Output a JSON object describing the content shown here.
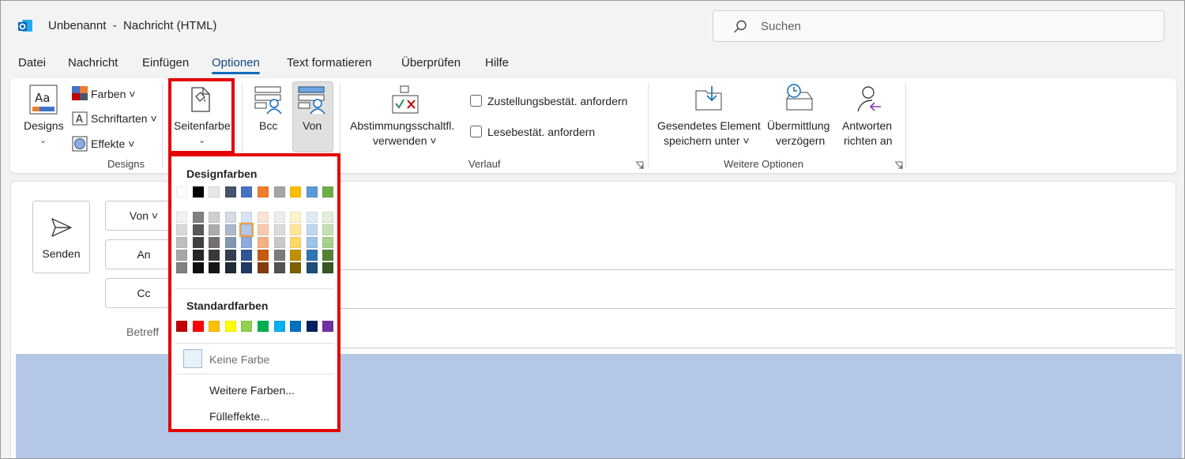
{
  "window": {
    "title": "Unbenannt  -  Nachricht (HTML)",
    "search_placeholder": "Suchen"
  },
  "menu": {
    "tabs": [
      "Datei",
      "Nachricht",
      "Einfügen",
      "Optionen",
      "Text formatieren",
      "Überprüfen",
      "Hilfe"
    ],
    "active_tab": "Optionen"
  },
  "ribbon": {
    "designs_group": {
      "designs_button": "Designs",
      "farben": "Farben",
      "schriftarten": "Schriftarten",
      "effekte": "Effekte",
      "label": "Designs"
    },
    "seitenfarbe": "Seitenfarbe",
    "bcc": "Bcc",
    "von": "Von",
    "verlauf_group": {
      "abstimmung_line1": "Abstimmungsschaltfl.",
      "abstimmung_line2": "verwenden",
      "zustellung": "Zustellungsbestät. anfordern",
      "lesebest": "Lesebestät. anfordern",
      "label": "Verlauf"
    },
    "weitere_group": {
      "gesendetes_line1": "Gesendetes Element",
      "gesendetes_line2": "speichern unter",
      "uebermittlung_line1": "Übermittlung",
      "uebermittlung_line2": "verzögern",
      "antworten_line1": "Antworten",
      "antworten_line2": "richten an",
      "label": "Weitere Optionen"
    }
  },
  "compose": {
    "send": "Senden",
    "von": "Von",
    "an": "An",
    "cc": "Cc",
    "betreff": "Betreff"
  },
  "dropdown": {
    "design_header": "Designfarben",
    "standard_header": "Standardfarben",
    "keine_farbe": "Keine Farbe",
    "weitere_farben": "Weitere Farben...",
    "fuelleffekte": "Fülleffekte...",
    "theme_colors": [
      [
        "#ffffff",
        "#f2f2f2",
        "#d9d9d9",
        "#bfbfbf",
        "#a6a6a6",
        "#808080"
      ],
      [
        "#000000",
        "#808080",
        "#595959",
        "#404040",
        "#262626",
        "#0d0d0d"
      ],
      [
        "#e7e6e6",
        "#d0cece",
        "#aeabab",
        "#757171",
        "#3a3838",
        "#171616"
      ],
      [
        "#44546a",
        "#d6dce5",
        "#adb9ca",
        "#8497b0",
        "#333f50",
        "#222a35"
      ],
      [
        "#4472c4",
        "#dae3f3",
        "#b4c7e7",
        "#8faadc",
        "#2f5597",
        "#203864"
      ],
      [
        "#ed7d31",
        "#fbe5d6",
        "#f8cbad",
        "#f4b183",
        "#c55a11",
        "#843c0c"
      ],
      [
        "#a5a5a5",
        "#ededed",
        "#dbdbdb",
        "#c9c9c9",
        "#7b7b7b",
        "#525252"
      ],
      [
        "#ffc000",
        "#fff2cc",
        "#ffe699",
        "#ffd966",
        "#bf9000",
        "#7f6000"
      ],
      [
        "#5b9bd5",
        "#deebf7",
        "#bdd7ee",
        "#9dc3e6",
        "#2e75b6",
        "#1f4e79"
      ],
      [
        "#70ad47",
        "#e2f0d9",
        "#c5e0b4",
        "#a9d18e",
        "#548235",
        "#385723"
      ]
    ],
    "standard_colors": [
      "#c00000",
      "#ff0000",
      "#ffc000",
      "#ffff00",
      "#92d050",
      "#00b050",
      "#00b0f0",
      "#0070c0",
      "#002060",
      "#7030a0"
    ],
    "selected_color": "#b4c7e7"
  }
}
